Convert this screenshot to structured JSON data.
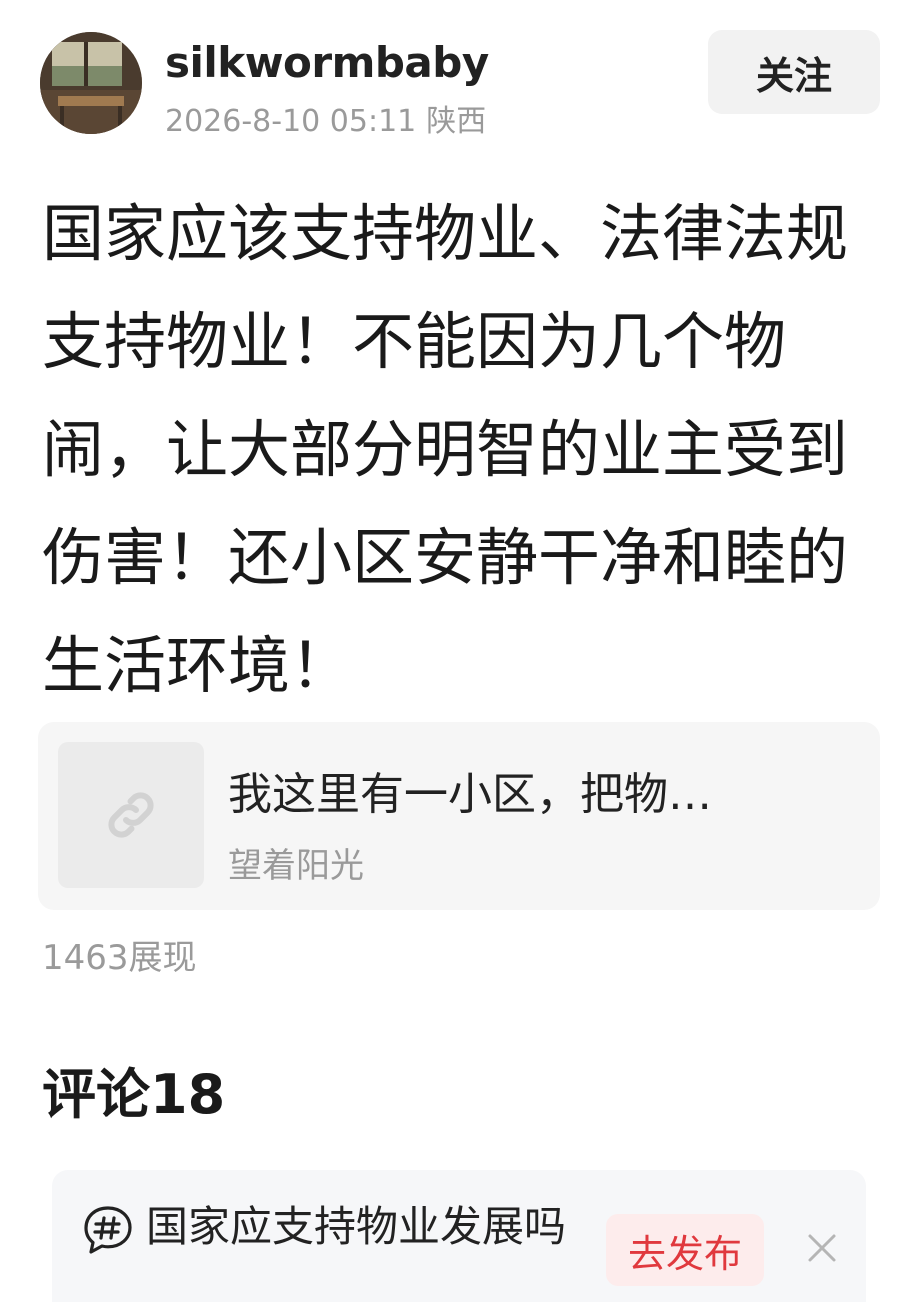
{
  "header": {
    "username": "silkwormbaby",
    "timestamp": "2026-8-10 05:11",
    "location": "陕西",
    "follow_label": "关注"
  },
  "post": {
    "text": "国家应该支持物业、法律法规支持物业！不能因为几个物闹，让大部分明智的业主受到伤害！还小区安静干净和睦的生活环境！"
  },
  "link_card": {
    "icon": "link-icon",
    "title": "我这里有一小区，把物…",
    "author": "望着阳光"
  },
  "stats": {
    "views": "1463展现"
  },
  "comments": {
    "title": "评论18"
  },
  "topic_bar": {
    "icon": "hashtag-icon",
    "text": "国家应支持物业发展吗",
    "publish_label": "去发布",
    "close_icon": "close-icon",
    "accent_color": "#e0393e"
  }
}
